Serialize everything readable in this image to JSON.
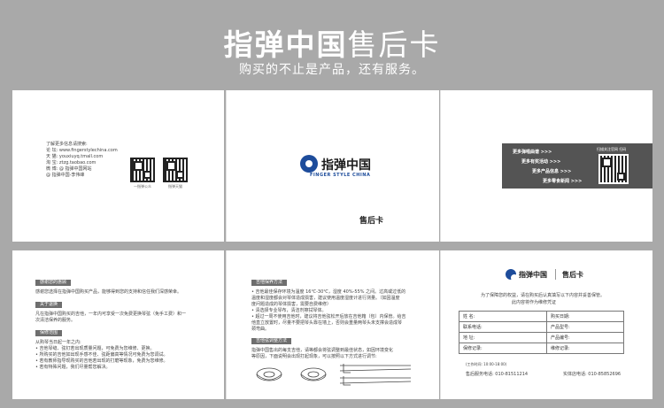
{
  "header": {
    "title_bold": "指弹中国",
    "title_light": "售后卡",
    "subtitle": "购买的不止是产品，还有服务。"
  },
  "panel1": {
    "intro": "了解更多信息请搜索:",
    "lines": [
      "论 坛: www.fingerstylechina.com",
      "天 猫: youxiuyq.tmall.com",
      "淘 宝: ztzg.taobao.com",
      "微 博: @ 指弹中国网站",
      "     @ 指弹中国-李伟峰"
    ],
    "qr_caption_1": "一指弹公众",
    "qr_caption_2": "指弹天猫"
  },
  "panel2": {
    "logo_cn": "指弹中国",
    "logo_en": "FINGER STYLE CHINA",
    "card_label": "售后卡"
  },
  "panel3": {
    "links": [
      "更多弹唱曲谱 >>>",
      "更多有奖活动 >>>",
      "更多产品信息 >>>",
      "更多零食新闻 >>>"
    ],
    "qr_title": "扫描关注官网 扫码"
  },
  "panel4": {
    "sections": [
      {
        "head": "感谢您的惠顾",
        "lines": [
          "感谢您选择在指弹中国购买产品，能够得到您的支持和信任我们深感荣幸。"
        ]
      },
      {
        "head": "关于退换",
        "lines": [
          "凡在指弹中国购买的吉他，一年内可享受一次免费更换琴弦（免手工费）和一",
          "次清洁保养的服务。"
        ]
      },
      {
        "head": "保修范围",
        "lines": [
          "从购琴当日起一年之内:",
          "• 吉他琴缝、弦钉若出现质量问题，可免费为您维修、更换。",
          "• 所购买的吉他如出现手感不佳、弦距偏高等情况可免费为您调试。",
          "• 若有教师指导现购买的吉他若出现的打磨等现象，免费为您维修。",
          "• 若有特殊问题，我们尽量帮您解决。"
        ]
      }
    ]
  },
  "panel5": {
    "sections": [
      {
        "head": "吉他保养方法",
        "lines": [
          "• 吉他最佳保存环境为温度 16℃-30℃，湿度 40%-55% 之间。过高或过低的",
          "  温度和湿度都会对琴体造成损害，建议使用温度湿度计进行测量。（如因温度",
          "  度问题造成的琴体损害，需要自费维修）",
          "• 清选择专业琴布，清洁剂擦拭琴体。",
          "• 超过一周不使用吉他时，建议将吉他弦松开后放在吉他箱（包）内保管。给吉",
          "  他直立放置时，尽量不要把琴头靠在墙上，否则会重量两琴头未支撑会造成琴",
          "  颈弯曲。"
        ]
      },
      {
        "head": "吉他弦调整方法",
        "lines": [
          "指弹中国售出的每支吉他，请等都会将弦调整到最佳状态，如因环境变化",
          "等原因，下面说明会出现打起现象，可以按照以下方式进行调节:"
        ]
      }
    ]
  },
  "panel6": {
    "logo_cn": "指弹中国",
    "card_label": "售后卡",
    "intro_1": "为了保障您的权益，请在购买后认真填写以下内容并妥善保管。",
    "intro_2": "此内容将作为维修凭证",
    "form": [
      [
        "姓  名:",
        "购买日期:"
      ],
      [
        "联系电话:",
        "产品型号:"
      ],
      [
        "地  址:",
        "产品编号:"
      ],
      [
        "保修记录:",
        "维修记录:"
      ]
    ],
    "hours": "(工作时间: 10:00-18:00)",
    "hotline": "售后服务电话: 010-81511214",
    "complaint": "实体店电话: 010-85852696"
  }
}
